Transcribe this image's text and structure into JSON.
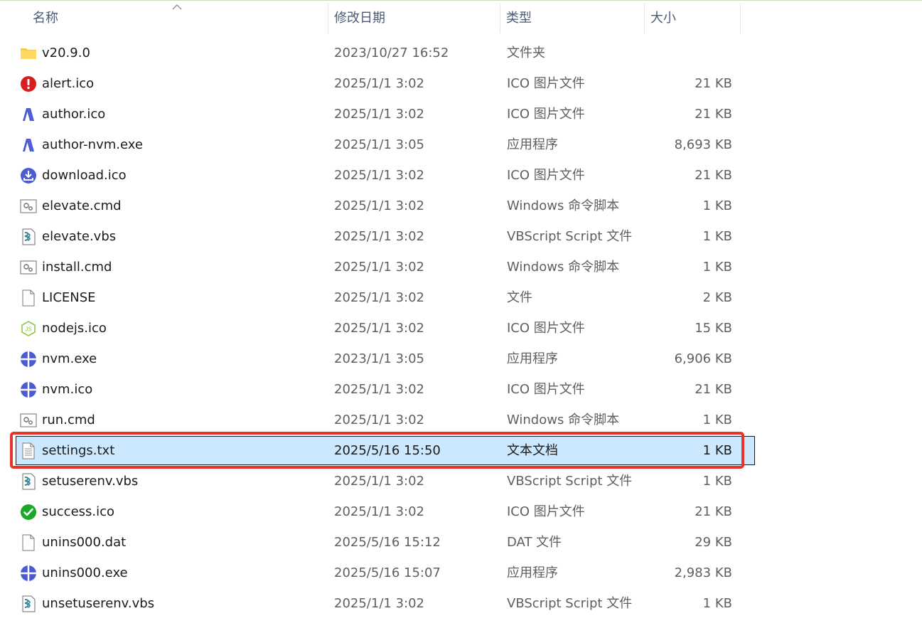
{
  "columns": {
    "name": "名称",
    "date": "修改日期",
    "type": "类型",
    "size": "大小"
  },
  "files": [
    {
      "name": "v20.9.0",
      "date": "2023/10/27 16:52",
      "type": "文件夹",
      "size": "",
      "icon": "folder-icon"
    },
    {
      "name": "alert.ico",
      "date": "2025/1/1 3:02",
      "type": "ICO 图片文件",
      "size": "21 KB",
      "icon": "alert-icon"
    },
    {
      "name": "author.ico",
      "date": "2025/1/1 3:02",
      "type": "ICO 图片文件",
      "size": "21 KB",
      "icon": "author-icon"
    },
    {
      "name": "author-nvm.exe",
      "date": "2025/1/1 3:05",
      "type": "应用程序",
      "size": "8,693 KB",
      "icon": "author-icon"
    },
    {
      "name": "download.ico",
      "date": "2025/1/1 3:02",
      "type": "ICO 图片文件",
      "size": "21 KB",
      "icon": "download-icon"
    },
    {
      "name": "elevate.cmd",
      "date": "2025/1/1 3:02",
      "type": "Windows 命令脚本",
      "size": "1 KB",
      "icon": "cmd-script-icon"
    },
    {
      "name": "elevate.vbs",
      "date": "2025/1/1 3:02",
      "type": "VBScript Script 文件",
      "size": "1 KB",
      "icon": "vbs-script-icon"
    },
    {
      "name": "install.cmd",
      "date": "2025/1/1 3:02",
      "type": "Windows 命令脚本",
      "size": "1 KB",
      "icon": "cmd-script-icon"
    },
    {
      "name": "LICENSE",
      "date": "2025/1/1 3:02",
      "type": "文件",
      "size": "2 KB",
      "icon": "blank-file-icon"
    },
    {
      "name": "nodejs.ico",
      "date": "2025/1/1 3:02",
      "type": "ICO 图片文件",
      "size": "15 KB",
      "icon": "nodejs-icon"
    },
    {
      "name": "nvm.exe",
      "date": "2023/1/1 3:05",
      "type": "应用程序",
      "size": "6,906 KB",
      "icon": "nvm-icon"
    },
    {
      "name": "nvm.ico",
      "date": "2025/1/1 3:02",
      "type": "ICO 图片文件",
      "size": "21 KB",
      "icon": "nvm-icon"
    },
    {
      "name": "run.cmd",
      "date": "2025/1/1 3:02",
      "type": "Windows 命令脚本",
      "size": "1 KB",
      "icon": "cmd-script-icon"
    },
    {
      "name": "settings.txt",
      "date": "2025/5/16 15:50",
      "type": "文本文档",
      "size": "1 KB",
      "icon": "text-file-icon",
      "selected": true
    },
    {
      "name": "setuserenv.vbs",
      "date": "2025/1/1 3:02",
      "type": "VBScript Script 文件",
      "size": "1 KB",
      "icon": "vbs-script-icon"
    },
    {
      "name": "success.ico",
      "date": "2025/1/1 3:02",
      "type": "ICO 图片文件",
      "size": "21 KB",
      "icon": "success-icon"
    },
    {
      "name": "unins000.dat",
      "date": "2025/5/16 15:12",
      "type": "DAT 文件",
      "size": "29 KB",
      "icon": "blank-file-icon"
    },
    {
      "name": "unins000.exe",
      "date": "2025/5/16 15:07",
      "type": "应用程序",
      "size": "2,983 KB",
      "icon": "nvm-icon"
    },
    {
      "name": "unsetuserenv.vbs",
      "date": "2025/1/1 3:02",
      "type": "VBScript Script 文件",
      "size": "1 KB",
      "icon": "vbs-script-icon"
    }
  ],
  "colors": {
    "selection_bg": "#cce8ff",
    "highlight_border": "#e8332a",
    "header_text": "#4a5a78"
  }
}
